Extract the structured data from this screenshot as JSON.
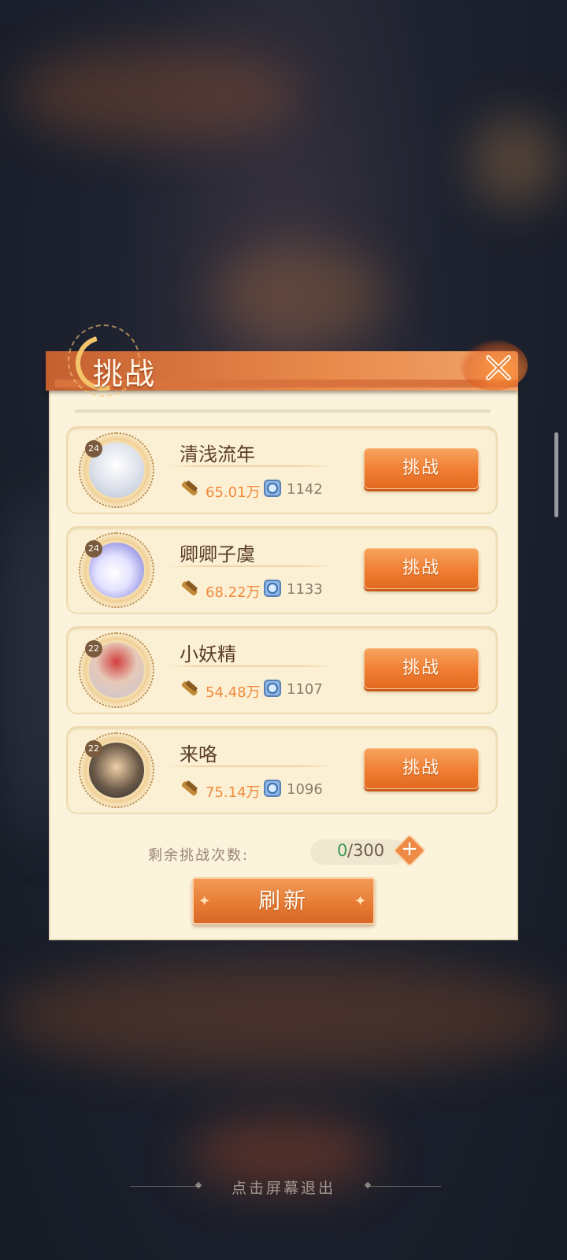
{
  "dialog": {
    "title": "挑战",
    "close_icon": "close-x-icon"
  },
  "opponents": [
    {
      "level": "24",
      "name": "清浅流年",
      "power": "65.01万",
      "score": "1142",
      "challenge_label": "挑战"
    },
    {
      "level": "24",
      "name": "卿卿子虞",
      "power": "68.22万",
      "score": "1133",
      "challenge_label": "挑战"
    },
    {
      "level": "22",
      "name": "小妖精",
      "power": "54.48万",
      "score": "1107",
      "challenge_label": "挑战"
    },
    {
      "level": "22",
      "name": "来咯",
      "power": "75.14万",
      "score": "1096",
      "challenge_label": "挑战"
    }
  ],
  "remaining": {
    "label": "剩余挑战次数:",
    "current": "0",
    "total": "/300"
  },
  "refresh_label": "刷新",
  "exit_hint": "点击屏幕退出",
  "colors": {
    "accent_orange": "#ef7d32",
    "power_text": "#f08a3c",
    "panel_bg": "#fcf3dc",
    "count_green": "#3d9a57"
  }
}
